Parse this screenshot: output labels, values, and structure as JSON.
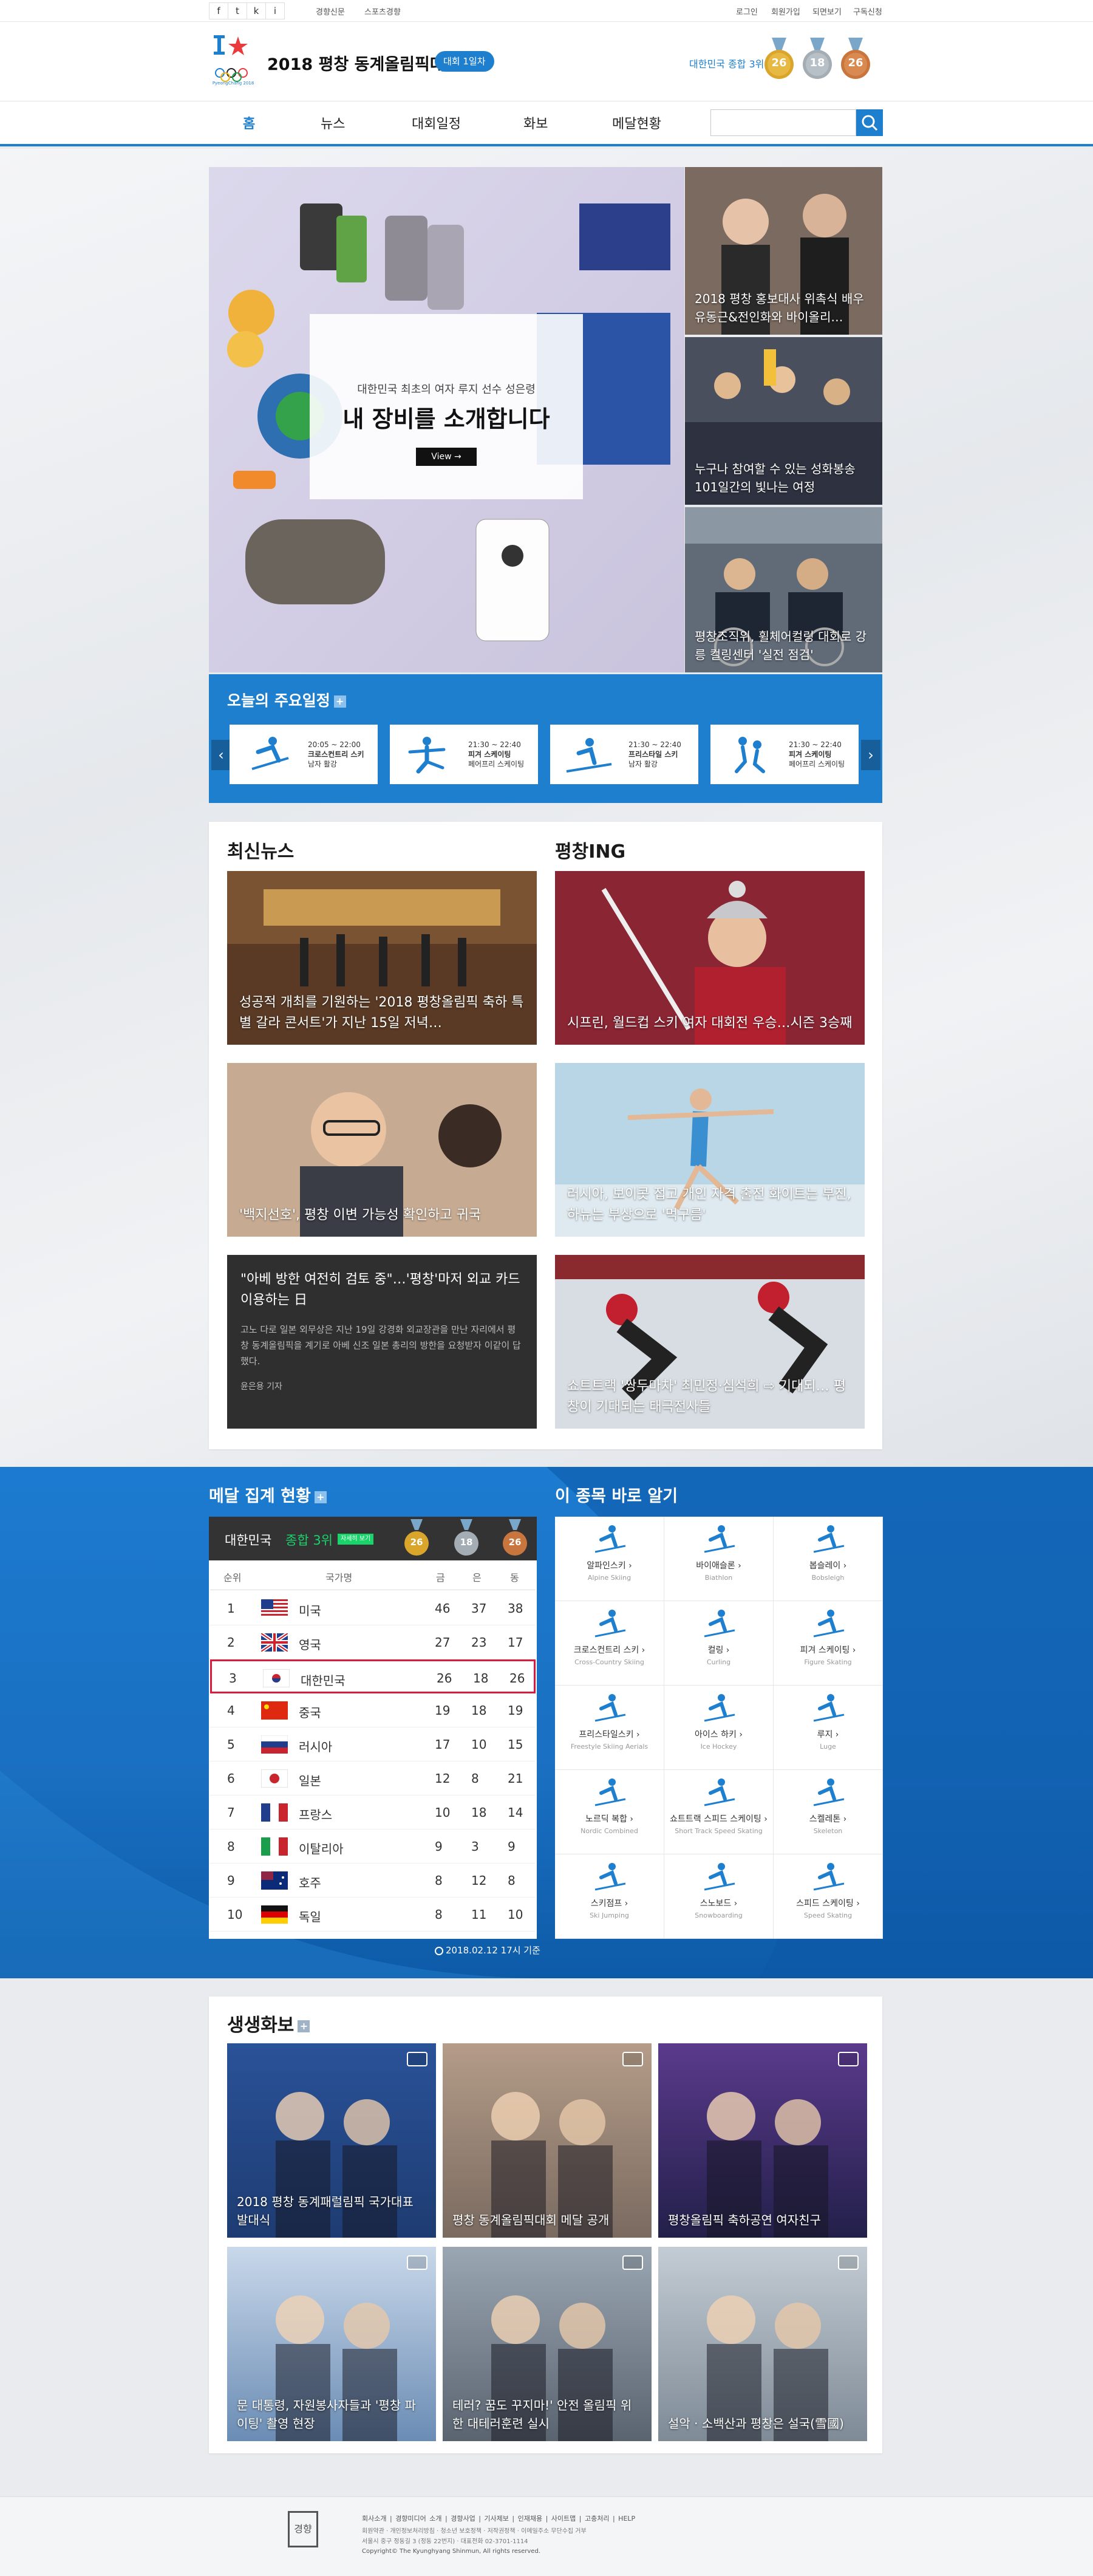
{
  "topbar": {
    "sns": [
      "f",
      "t",
      "k",
      "i"
    ],
    "links_left": [
      "경향신문",
      "스포츠경향"
    ],
    "links_right": [
      "로그인",
      "회원가입",
      "되면보기",
      "구독신청"
    ]
  },
  "header": {
    "title": "2018 평창 동계올림픽대회",
    "day_badge": "대회 1일차",
    "rank_text": "대한민국 종합 3위",
    "gold": "26",
    "silver": "18",
    "bronze": "26",
    "logo_text": "PyeongChang 2018"
  },
  "nav": {
    "items": [
      "홈",
      "뉴스",
      "대회일정",
      "화보",
      "메달현황"
    ],
    "search_placeholder": ""
  },
  "hero": {
    "kicker": "대한민국 최초의 여자 루지 선수 성은령",
    "title": "내 장비를 소개합니다",
    "button": "View →",
    "side": [
      {
        "caption": "2018 평창 홍보대사 위촉식 배우 유동근&전인화와 바이올리…"
      },
      {
        "caption": "누구나 참여할 수 있는 성화봉송 101일간의 빛나는 여정"
      },
      {
        "caption": "평창조직위, 휠체어컬링 대회로 강릉 컬링센터 '실전 점검'"
      }
    ]
  },
  "schedule": {
    "title": "오늘의 주요일정",
    "items": [
      {
        "time": "20:05 ~ 22:00",
        "event": "크로스컨트리 스키",
        "sub": "남자 활강"
      },
      {
        "time": "21:30 ~ 22:40",
        "event": "피겨 스케이팅",
        "sub": "페어프리 스케이팅"
      },
      {
        "time": "21:30 ~ 22:40",
        "event": "프리스타일 스키",
        "sub": "남자 활강"
      },
      {
        "time": "21:30 ~ 22:40",
        "event": "피겨 스케이팅",
        "sub": "페어프리 스케이팅"
      }
    ]
  },
  "news": {
    "title": "최신뉴스",
    "items": [
      "성공적 개최를 기원하는 '2018 평창올림픽 축하 특별 갈라 콘서트'가 지난 15일 저녁…",
      "'백지선호', 평창 이변 가능성 확인하고 귀국"
    ],
    "text_item": {
      "title": "\"아베 방한 여전히 검토 중\"…'평창'마저 외교 카드 이용하는 日",
      "body": "고노 다로 일본 외무상은 지난 19일 강경화 외교장관을 만난 자리에서 평창 동계올림픽을 계기로 아베 신조 일본 총리의 방한을 요청받자 이같이 답했다.",
      "author": "윤은용 기자"
    }
  },
  "pcing": {
    "title": "평창ING",
    "items": [
      "시프린, 월드컵 스키 여자 대회전 우승…시즌 3승째",
      "러시아, 보이콧 접고 개인 자격 출전 화이트는 부진, 하뉴는 부상으로 '먹구름'",
      "쇼트트랙 '쌍두마차' 최민정·심석희 ⇨ 기대되… 평창이 기대되는 태극전사들"
    ]
  },
  "medals": {
    "title": "메달 집계 현황",
    "korea_label": "대한민국",
    "korea_rank": "종합 3위",
    "detail_badge": "자세히 보기",
    "headers": [
      "순위",
      "국가명",
      "금",
      "은",
      "동"
    ],
    "rows": [
      [
        "1",
        "미국",
        "46",
        "37",
        "38"
      ],
      [
        "2",
        "영국",
        "27",
        "23",
        "17"
      ],
      [
        "3",
        "대한민국",
        "26",
        "18",
        "26"
      ],
      [
        "4",
        "중국",
        "19",
        "18",
        "19"
      ],
      [
        "5",
        "러시아",
        "17",
        "10",
        "15"
      ],
      [
        "6",
        "일본",
        "12",
        "8",
        "21"
      ],
      [
        "7",
        "프랑스",
        "10",
        "18",
        "14"
      ],
      [
        "8",
        "이탈리아",
        "9",
        "3",
        "9"
      ],
      [
        "9",
        "호주",
        "8",
        "12",
        "8"
      ],
      [
        "10",
        "독일",
        "8",
        "11",
        "10"
      ]
    ],
    "updated": "2018.02.12 17시 기준"
  },
  "sports": {
    "title": "이 종목 바로 알기",
    "items": [
      {
        "ko": "알파인스키 ›",
        "en": "Alpine Skiing"
      },
      {
        "ko": "바이애슬론 ›",
        "en": "Biathlon"
      },
      {
        "ko": "봅슬레이 ›",
        "en": "Bobsleigh"
      },
      {
        "ko": "크로스컨트리 스키 ›",
        "en": "Cross-Country Skiing"
      },
      {
        "ko": "컬링 ›",
        "en": "Curling"
      },
      {
        "ko": "피겨 스케이팅 ›",
        "en": "Figure Skating"
      },
      {
        "ko": "프리스타일스키 ›",
        "en": "Freestyle Skiing Aerials"
      },
      {
        "ko": "아이스 하키 ›",
        "en": "Ice Hockey"
      },
      {
        "ko": "루지 ›",
        "en": "Luge"
      },
      {
        "ko": "노르딕 복합 ›",
        "en": "Nordic Combined"
      },
      {
        "ko": "쇼트트랙 스피드 스케이팅 ›",
        "en": "Short Track Speed Skating"
      },
      {
        "ko": "스켈레톤 ›",
        "en": "Skeleton"
      },
      {
        "ko": "스키점프 ›",
        "en": "Ski Jumping"
      },
      {
        "ko": "스노보드 ›",
        "en": "Snowboarding"
      },
      {
        "ko": "스피드 스케이팅 ›",
        "en": "Speed Skating"
      }
    ]
  },
  "gallery": {
    "title": "생생화보",
    "items": [
      "2018 평창 동계패럴림픽 국가대표 발대식",
      "평창 동계올림픽대회 메달 공개",
      "평창올림픽 축하공연 여자친구",
      "문 대통령, 자원봉사자들과 '평창 파이팅' 촬영 현장",
      "테러? 꿈도 꾸지마!' 안전 올림픽 위한 대테러훈련 실시",
      "설악 · 소백산과 평창은 설국(雪國)"
    ]
  },
  "footer": {
    "logo": "경향",
    "links": [
      "회사소개",
      "경향미디어 소개",
      "경향사업",
      "기사제보",
      "인재채용",
      "사이트맵",
      "고충처리",
      "HELP"
    ],
    "line2": "회원약관 · 개인정보처리방침 · 청소년 보호정책 · 저작권정책 · 이메일주소 무단수집 거부",
    "line3": "서울시 중구 정동길 3 (정동 22번지) · 대표전화 02-3701-1114",
    "copyright": "Copyright© The Kyunghyang Shinmun, All rights reserved."
  },
  "colors": {
    "accent": "#1f7fcf",
    "dark_blue": "#0b5aa6",
    "gold": "#d9a62b",
    "silver": "#a4acb4",
    "bronze": "#c9753e",
    "highlight": "#d81c3f"
  }
}
